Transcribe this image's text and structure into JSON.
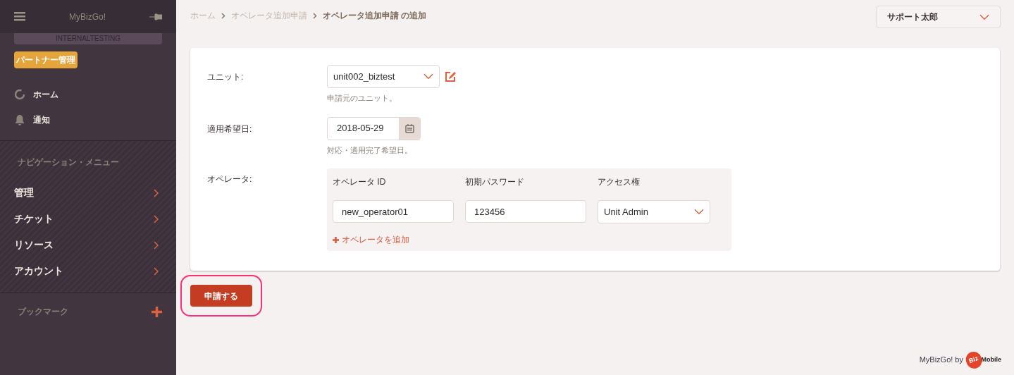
{
  "sidebar": {
    "app_title": "MyBizGo!",
    "environment": "INTERNALTESTING",
    "role_badge": "パートナー管理",
    "quick_links": [
      {
        "label": "ホーム",
        "kind": "home"
      },
      {
        "label": "通知",
        "kind": "bell"
      }
    ],
    "nav_heading": "ナビゲーション・メニュー",
    "nav_items": [
      {
        "label": "管理"
      },
      {
        "label": "チケット"
      },
      {
        "label": "リソース"
      },
      {
        "label": "アカウント"
      }
    ],
    "bookmarks_heading": "ブックマーク"
  },
  "breadcrumb": [
    {
      "label": "ホーム",
      "current": false
    },
    {
      "label": "オペレータ追加申請",
      "current": false
    },
    {
      "label": "オペレータ追加申請 の追加",
      "current": true
    }
  ],
  "user_menu": {
    "label": "サポート太郎"
  },
  "form": {
    "unit": {
      "label": "ユニット:",
      "value": "unit002_biztest",
      "help": "申請元のユニット。"
    },
    "date": {
      "label": "適用希望日:",
      "value": "2018-05-29",
      "help": "対応・適用完了希望日。"
    },
    "operators": {
      "label": "オペレータ:",
      "columns": [
        "オペレータ ID",
        "初期パスワード",
        "アクセス権"
      ],
      "rows": [
        {
          "id": "new_operator01",
          "password": "123456",
          "access": "Unit Admin"
        }
      ],
      "add_link": "オペレータを追加"
    }
  },
  "submit_button": {
    "label": "申請する",
    "highlighted": true
  },
  "footer": {
    "text": "MyBizGo! by",
    "logo_parts": [
      "Biz",
      "Mobile"
    ]
  }
}
